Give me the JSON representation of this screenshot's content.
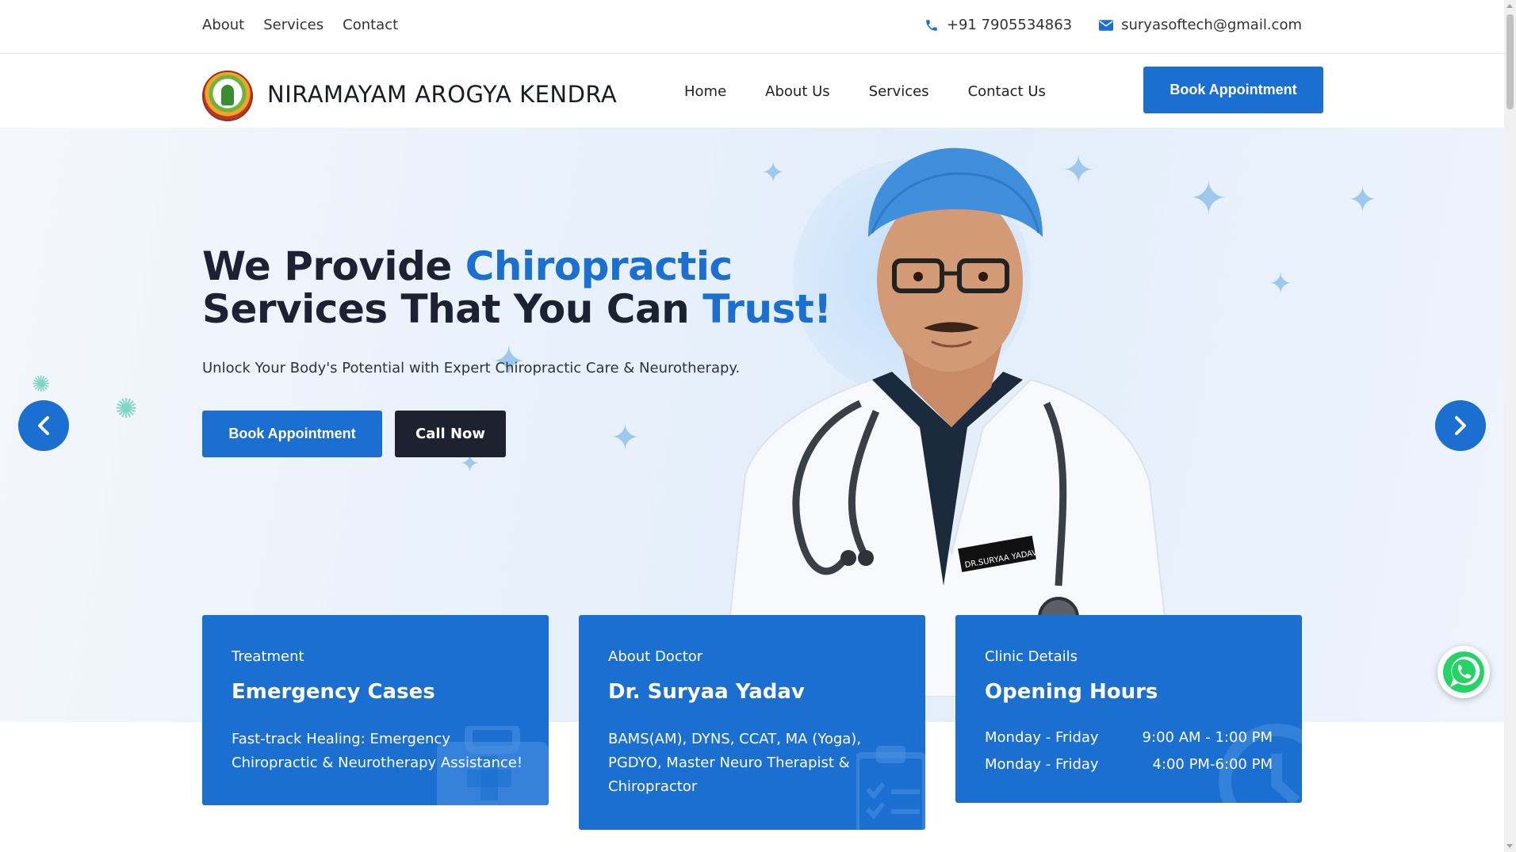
{
  "topbar": {
    "links": [
      "About",
      "Services",
      "Contact"
    ],
    "phone": "+91 7905534863",
    "email": "suryasoftech@gmail.com"
  },
  "navbar": {
    "brand": "NIRAMAYAM AROGYA KENDRA",
    "menu": [
      "Home",
      "About Us",
      "Services",
      "Contact Us"
    ],
    "cta": "Book Appointment"
  },
  "hero": {
    "heading_line1_plain": "We Provide ",
    "heading_line1_accent": "Chiropractic",
    "heading_line2_plain": "Services That You Can ",
    "heading_line2_accent": "Trust!",
    "subtitle": "Unlock Your Body's Potential with Expert Chiropractic Care & Neurotherapy.",
    "btn_book": "Book Appointment",
    "btn_call": "Call Now",
    "badge_name": "DR.SURYAA YADAV"
  },
  "cards": [
    {
      "eyebrow": "Treatment",
      "title": "Emergency Cases",
      "body": "Fast-track Healing: Emergency Chiropractic & Neurotherapy Assistance!"
    },
    {
      "eyebrow": "About Doctor",
      "title": "Dr. Suryaa Yadav",
      "body": "BAMS(AM), DYNS, CCAT, MA (Yoga), PGDYO, Master Neuro Therapist & Chiropractor"
    },
    {
      "eyebrow": "Clinic Details",
      "title": "Opening Hours",
      "hours": [
        {
          "days": "Monday - Friday",
          "time": "9:00 AM - 1:00 PM"
        },
        {
          "days": "Monday - Friday",
          "time": "4:00 PM-6:00 PM"
        }
      ]
    }
  ],
  "colors": {
    "primary": "#1a6fd1",
    "dark": "#1e2230",
    "whatsapp": "#25d366"
  }
}
